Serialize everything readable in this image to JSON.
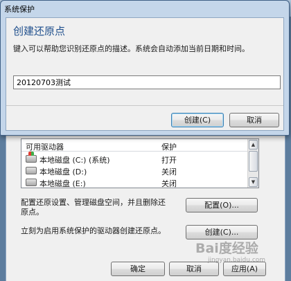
{
  "parent": {
    "close_glyph": "✕",
    "drive_list": {
      "headers": [
        "可用驱动器",
        "保护"
      ],
      "rows": [
        {
          "name": "本地磁盘 (C:) (系统)",
          "protection": "打开",
          "icon": "system-drive-icon"
        },
        {
          "name": "本地磁盘 (D:)",
          "protection": "关闭",
          "icon": "drive-icon"
        },
        {
          "name": "本地磁盘 (E:)",
          "protection": "关闭",
          "icon": "drive-icon"
        }
      ]
    },
    "configure_text": "配置还原设置、管理磁盘空间，并且删除还原点。",
    "configure_text_line1": "配置还原设置、管理磁盘空间，并且删除还",
    "configure_text_line2": "原点。",
    "configure_button": "配置(O)...",
    "create_text": "立刻为启用系统保护的驱动器创建还原点。",
    "create_button": "创建(C)...",
    "ok_button": "确定",
    "cancel_button": "取消",
    "apply_button": "应用(A)"
  },
  "watermark": {
    "logo": "Bai度经验",
    "url": "jingyan.baidu.com"
  },
  "dialog": {
    "title": "系统保护",
    "heading": "创建还原点",
    "description": "键入可以帮助您识别还原点的描述。系统会自动添加当前日期和时间。",
    "input_value": "20120703测试",
    "create_button": "创建(C)",
    "cancel_button": "取消"
  },
  "colors": {
    "heading": "#1e4e8c",
    "title_bar": "#c4d6ea",
    "close_button": "#c7412b"
  }
}
